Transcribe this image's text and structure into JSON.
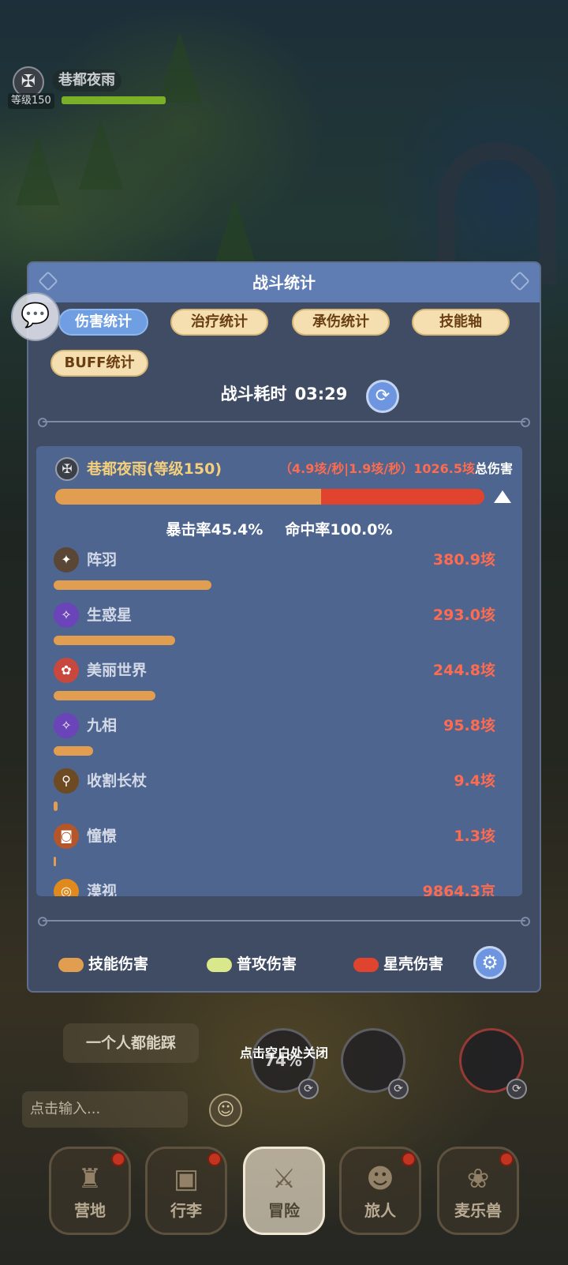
{
  "player": {
    "name": "巷都夜雨",
    "level_label": "等级150"
  },
  "battle_stats": {
    "title": "战斗统计",
    "tabs": [
      {
        "label": "伤害统计",
        "active": true
      },
      {
        "label": "治疗统计",
        "active": false
      },
      {
        "label": "承伤统计",
        "active": false
      },
      {
        "label": "技能轴",
        "active": false
      },
      {
        "label": "BUFF统计",
        "active": false
      }
    ],
    "duration_label": "战斗耗时",
    "duration_value": "03:29",
    "entry": {
      "name": "巷都夜雨(等级150)",
      "dps_text": "（4.9垓/秒|1.9垓/秒）1026.5垓",
      "total_label": "总伤害",
      "skill_damage_fraction": 0.62,
      "crit_rate": "暴击率45.4%",
      "hit_rate": "命中率100.0%"
    },
    "skills": [
      {
        "name": "阵羽",
        "value": "380.9垓",
        "share": 0.371,
        "icon": "dark-bird-icon",
        "color": "#5a4634"
      },
      {
        "name": "生惑星",
        "value": "293.0垓",
        "share": 0.285,
        "icon": "purple-wing-icon",
        "color": "#6a44b8"
      },
      {
        "name": "美丽世界",
        "value": "244.8垓",
        "share": 0.239,
        "icon": "red-flower-icon",
        "color": "#c8483e"
      },
      {
        "name": "九相",
        "value": "95.8垓",
        "share": 0.093,
        "icon": "purple-wing-icon",
        "color": "#6a44b8"
      },
      {
        "name": "收割长杖",
        "value": "9.4垓",
        "share": 0.009,
        "icon": "staff-icon",
        "color": "#6e4a22"
      },
      {
        "name": "憧憬",
        "value": "1.3垓",
        "share": 0.001,
        "icon": "chest-icon",
        "color": "#b5562a"
      },
      {
        "name": "漠视",
        "value": "9864.3京",
        "share": 0.0001,
        "icon": "sun-ring-icon",
        "color": "#e08a1e"
      }
    ],
    "legend": [
      {
        "label": "技能伤害",
        "color": "#e19e51"
      },
      {
        "label": "普攻伤害",
        "color": "#d8e88a"
      },
      {
        "label": "星壳伤害",
        "color": "#e0432e"
      }
    ]
  },
  "overlay": {
    "close_hint": "点击空白处关闭",
    "quick_phrase": "一个人都能踩",
    "chat_placeholder": "点击输入...",
    "orb_percent": "74%"
  },
  "nav": [
    {
      "label": "营地",
      "icon": "castle-icon",
      "badge": true,
      "active": false
    },
    {
      "label": "行李",
      "icon": "backpack-icon",
      "badge": true,
      "active": false
    },
    {
      "label": "冒险",
      "icon": "crossed-swords-icon",
      "badge": false,
      "active": true
    },
    {
      "label": "旅人",
      "icon": "traveler-icon",
      "badge": true,
      "active": false
    },
    {
      "label": "麦乐兽",
      "icon": "beast-icon",
      "badge": true,
      "active": false
    }
  ],
  "colors": {
    "skill_bar": "#e19e51",
    "shell_bar": "#e0432e",
    "header": "#5f7db3",
    "panel": "#4e6590",
    "damage_text": "#ff6b4f"
  }
}
